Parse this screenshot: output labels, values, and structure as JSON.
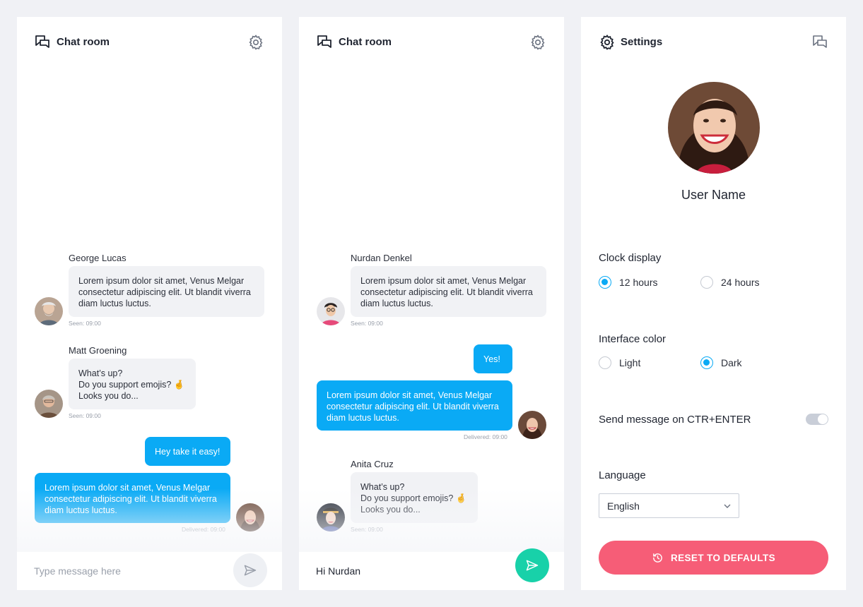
{
  "colors": {
    "accent": "#0aaaf5",
    "send_active": "#18d1a9",
    "reset": "#f65d77",
    "incoming_bubble": "#f1f2f5"
  },
  "chat1": {
    "title": "Chat room",
    "title_icon": "chat-bubbles-icon",
    "settings_icon": "gear-icon",
    "messages": [
      {
        "sender": "George Lucas",
        "text": "Lorem ipsum dolor sit amet, Venus Melgar\nconsectetur adipiscing elit. Ut blandit viverra\ndiam luctus luctus.",
        "meta": "Seen: 09:00"
      },
      {
        "sender": "Matt Groening",
        "text": "What’s up?\nDo you support emojis? 🤞\nLooks you do...",
        "meta": "Seen: 09:00"
      },
      {
        "text": "Hey take it easy!"
      },
      {
        "text": "Lorem ipsum dolor sit amet, Venus Melgar\nconsectetur adipiscing elit. Ut blandit viverra\ndiam luctus luctus.",
        "meta": "Delivered: 09:00"
      }
    ],
    "composer": {
      "placeholder": "Type message here"
    }
  },
  "chat2": {
    "title": "Chat room",
    "title_icon": "chat-bubbles-icon",
    "settings_icon": "gear-icon",
    "messages": [
      {
        "sender": "Nurdan Denkel",
        "text": "Lorem ipsum dolor sit amet, Venus Melgar\nconsectetur adipiscing elit. Ut blandit viverra\ndiam luctus luctus.",
        "meta": "Seen: 09:00"
      },
      {
        "text": "Yes!"
      },
      {
        "text": "Lorem ipsum dolor sit amet, Venus Melgar\nconsectetur adipiscing elit. Ut blandit viverra\ndiam luctus luctus.",
        "meta": "Delivered: 09:00"
      },
      {
        "sender": "Anita Cruz",
        "text": "What’s up?\nDo you support emojis? 🤞\nLooks you do...",
        "meta": "Seen: 09:00"
      }
    ],
    "composer": {
      "value": "Hi Nurdan"
    }
  },
  "settings": {
    "title": "Settings",
    "user_name": "User Name",
    "clock": {
      "label": "Clock display",
      "options": [
        "12 hours",
        "24 hours"
      ],
      "selected": "12 hours"
    },
    "interface_color": {
      "label": "Interface color",
      "options": [
        "Light",
        "Dark"
      ],
      "selected": "Dark"
    },
    "send_on_ctrl_enter": {
      "label": "Send message on CTR+ENTER",
      "enabled": true
    },
    "language": {
      "label": "Language",
      "value": "English"
    },
    "reset_label": "RESET TO DEFAULTS"
  }
}
